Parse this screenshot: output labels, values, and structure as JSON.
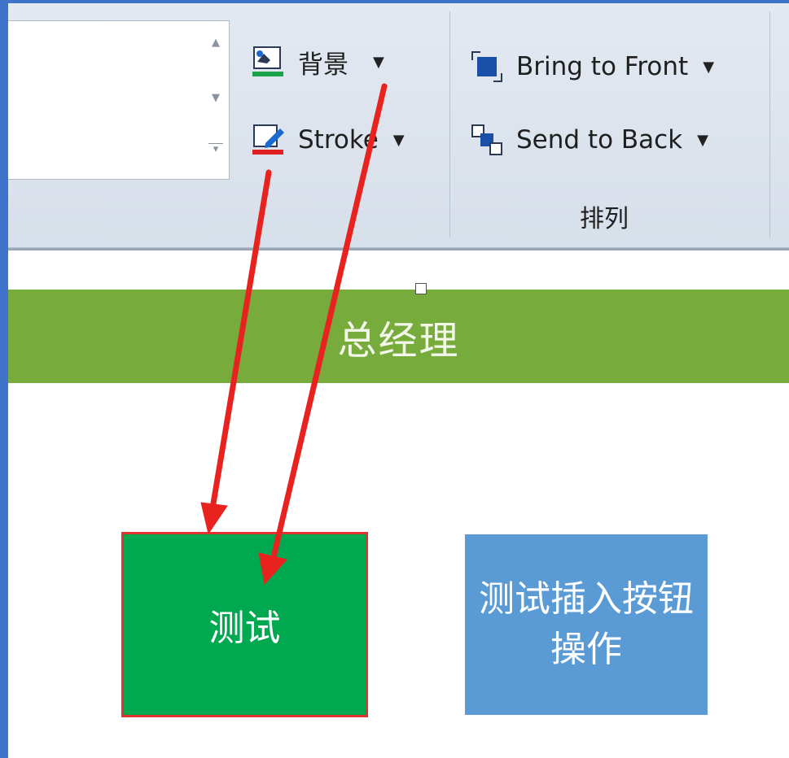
{
  "ribbon": {
    "style_gallery": {
      "scroll_up": "▲",
      "scroll_down": "▼",
      "more": "▾"
    },
    "background": {
      "label": "背景",
      "dropdown": "▼",
      "icon": "fill-color-icon",
      "indicator_color": "#1aa34a"
    },
    "stroke": {
      "label": "Stroke",
      "dropdown": "▼",
      "icon": "pen-icon",
      "indicator_color": "#e02020"
    },
    "bring_to_front": {
      "label": "Bring to Front",
      "dropdown": "▼",
      "icon": "bring-to-front-icon"
    },
    "send_to_back": {
      "label": "Send to Back",
      "dropdown": "▼",
      "icon": "send-to-back-icon"
    },
    "arrange_group_label": "排列"
  },
  "canvas": {
    "title_bar": {
      "text": "总经理",
      "color": "#77ab3c"
    },
    "green_button": {
      "text": "测试",
      "fill": "#00a84f",
      "border": "#e23333"
    },
    "blue_button": {
      "text": "测试插入按钮操作",
      "fill": "#5b9bd5"
    }
  },
  "annotation_color": "#e8231f"
}
